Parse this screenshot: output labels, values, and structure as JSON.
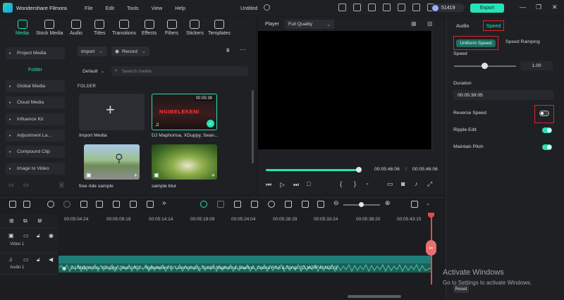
{
  "titlebar": {
    "app_name": "Wondershare Filmora",
    "menus": [
      "File",
      "Edit",
      "Tools",
      "View",
      "Help"
    ],
    "doc_title": "Untitled",
    "credits": "51419",
    "export_label": "Export",
    "window_controls": [
      "—",
      "❐",
      "✕"
    ]
  },
  "media_toolbar": {
    "items": [
      {
        "label": "Media",
        "icon": "media-icon",
        "active": true
      },
      {
        "label": "Stock Media",
        "icon": "stock-media-icon"
      },
      {
        "label": "Audio",
        "icon": "audio-icon"
      },
      {
        "label": "Titles",
        "icon": "titles-icon"
      },
      {
        "label": "Transitions",
        "icon": "transitions-icon"
      },
      {
        "label": "Effects",
        "icon": "effects-icon"
      },
      {
        "label": "Filters",
        "icon": "filters-icon"
      },
      {
        "label": "Stickers",
        "icon": "stickers-icon"
      },
      {
        "label": "Templates",
        "icon": "templates-icon"
      }
    ]
  },
  "sidebar": {
    "items": [
      "Project Media",
      "Global Media",
      "Cloud Media",
      "Influence Kit",
      "Adjustment La...",
      "Compound Clip",
      "Image to Video"
    ],
    "folder_label": "Folder"
  },
  "media": {
    "import_label": "Import",
    "record_label": "Record",
    "sort_label": "Default",
    "search_placeholder": "Search media",
    "folder_heading": "FOLDER",
    "items": [
      {
        "label": "Import Media"
      },
      {
        "label": "DJ Maphorisa, XDuppy, Sean...",
        "duration": "00:05:39",
        "overlay_text": "NGIBELEKENI"
      },
      {
        "label": "free ride sample"
      },
      {
        "label": "sample blur"
      }
    ]
  },
  "player": {
    "label": "Player",
    "quality": "Full Quality",
    "current_time": "00:05:46:06",
    "total_time": "00:05:46:06",
    "progress_fraction": 1.0
  },
  "right_panel": {
    "tabs": [
      "Audio",
      "Speed"
    ],
    "active_tab": "Speed",
    "subtabs": [
      "Uniform Speed",
      "Speed Ramping"
    ],
    "speed_label": "Speed",
    "speed_value": "1.00",
    "duration_label": "Duration",
    "duration_value": "00:05:39:05",
    "options": [
      {
        "label": "Reverse Speed",
        "on": false
      },
      {
        "label": "Ripple Edit",
        "on": true
      },
      {
        "label": "Maintain Pitch",
        "on": true
      }
    ],
    "reset_label": "Reset"
  },
  "timeline": {
    "ticks": [
      "00:05:04:24",
      "00:05:09:19",
      "00:05:14:14",
      "00:05:19:09",
      "00:05:24:04",
      "00:05:28:29",
      "00:05:33:24",
      "00:05:38:20",
      "00:05:43:15"
    ],
    "tracks": [
      {
        "label": "Video 1",
        "number": "1"
      },
      {
        "label": "Audio 1",
        "number": "1"
      }
    ],
    "clip_name": "DJ Maphorisa, XDuppy, Sean1401 - Ngibelekeni ft. Leemckrazy, Scotts Maphuma, Baeline, Ceeka RSA & Slings [CLMZ4F4AN2D0]"
  },
  "watermark": {
    "title": "Activate Windows",
    "subtitle": "Go to Settings to activate Windows."
  },
  "colors": {
    "accent": "#25e3b4",
    "highlight": "#e0242b",
    "playhead": "#e54b4b",
    "background": "#1b1d20"
  }
}
